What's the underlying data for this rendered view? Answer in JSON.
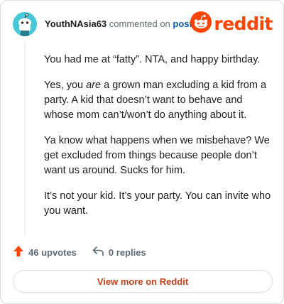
{
  "comment": {
    "username": "YouthNAsia63",
    "commented_on": "commented on",
    "post_link": "post",
    "paragraphs": [
      {
        "before": "You had me at “fatty”. NTA, and happy birthday.",
        "em": "",
        "after": ""
      },
      {
        "before": "Yes, you ",
        "em": "are",
        "after": " a grown man excluding a kid from a party. A kid that doesn’t want to behave and whose mom can’t/won’t do anything about it."
      },
      {
        "before": "Ya know what happens when we misbehave? We get excluded from things because people don’t want us around. Sucks for him.",
        "em": "",
        "after": ""
      },
      {
        "before": "It’s not your kid. It’s your party. You can invite who you want.",
        "em": "",
        "after": ""
      }
    ],
    "upvotes": "46 upvotes",
    "replies": "0 replies"
  },
  "brand": {
    "wordmark": "reddit",
    "color": "#ff4500"
  },
  "footer": {
    "view_more": "View more on Reddit"
  },
  "icons": {
    "avatar": "snoo-avatar-icon",
    "logo": "reddit-logo-icon",
    "upvote": "upvote-arrow-icon",
    "reply": "reply-arrow-icon"
  }
}
